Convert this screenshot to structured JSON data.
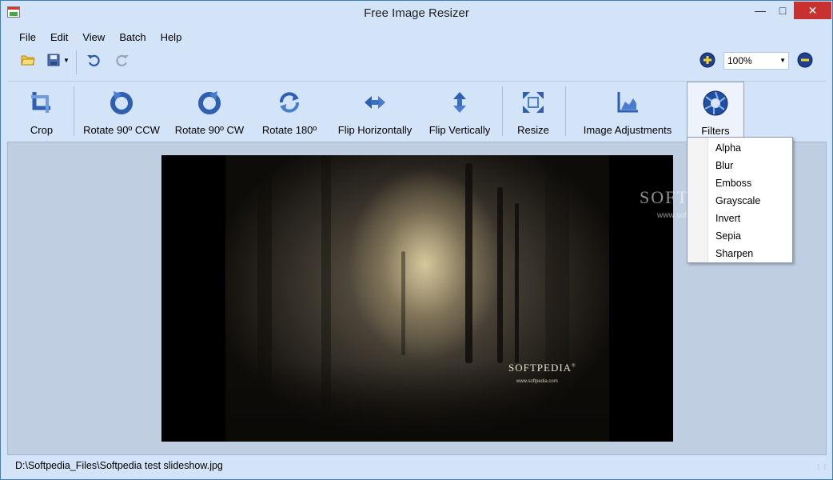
{
  "window": {
    "title": "Free Image Resizer"
  },
  "menu": [
    "File",
    "Edit",
    "View",
    "Batch",
    "Help"
  ],
  "zoom": {
    "value": "100%"
  },
  "toolbar": [
    {
      "label": "Crop",
      "icon": "crop-icon"
    },
    {
      "label": "Rotate 90º CCW",
      "icon": "rotate-ccw-icon"
    },
    {
      "label": "Rotate 90º CW",
      "icon": "rotate-cw-icon"
    },
    {
      "label": "Rotate 180º",
      "icon": "rotate-180-icon"
    },
    {
      "label": "Flip Horizontally",
      "icon": "flip-horizontal-icon"
    },
    {
      "label": "Flip Vertically",
      "icon": "flip-vertical-icon"
    },
    {
      "label": "Resize",
      "icon": "resize-icon"
    },
    {
      "label": "Image Adjustments",
      "icon": "image-adjustments-icon"
    },
    {
      "label": "Filters",
      "icon": "filters-icon"
    }
  ],
  "filters_menu": [
    "Alpha",
    "Blur",
    "Emboss",
    "Grayscale",
    "Invert",
    "Sepia",
    "Sharpen"
  ],
  "image": {
    "watermark": "SOFTPEDIA",
    "watermark_mark": "®",
    "url": "www.softpedia.com"
  },
  "background_watermark": {
    "text": "SOFTPEDIA",
    "url": "www.softpedia.com"
  },
  "status": {
    "path": "D:\\Softpedia_Files\\Softpedia test slideshow.jpg"
  },
  "colors": {
    "accent": "#3a6ec0",
    "close_button": "#c7312f",
    "canvas": "#c0cee2"
  }
}
